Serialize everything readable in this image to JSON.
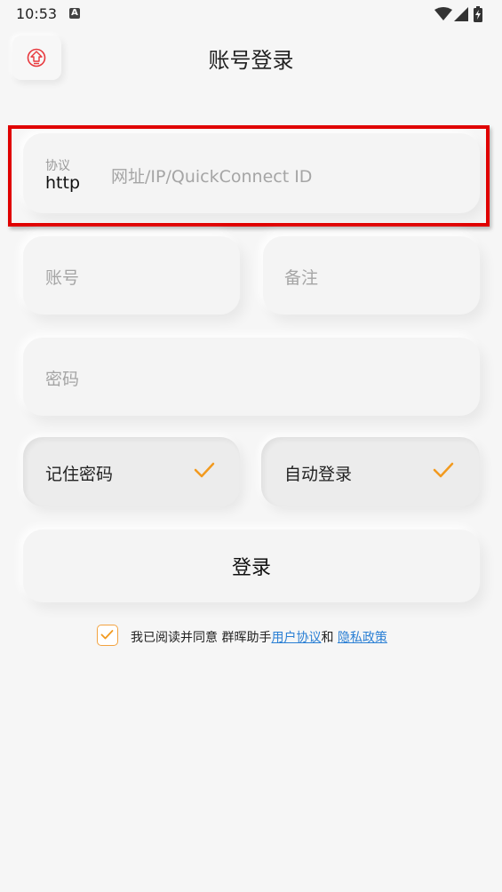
{
  "status_bar": {
    "time": "10:53",
    "notification_glyph": "A",
    "icons": [
      "wifi-icon",
      "signal-icon",
      "battery-charging-icon"
    ]
  },
  "header": {
    "title": "账号登录",
    "back_icon": "back-home-icon",
    "accent_color": "#e8383d"
  },
  "form": {
    "protocol_caption": "协议",
    "protocol_value": "http",
    "url_placeholder": "网址/IP/QuickConnect ID",
    "account_placeholder": "账号",
    "remark_placeholder": "备注",
    "password_placeholder": "密码"
  },
  "options": {
    "remember_label": "记住密码",
    "remember_checked": true,
    "autologin_label": "自动登录",
    "autologin_checked": true,
    "check_color": "#f29a1f"
  },
  "login_button": "登录",
  "agreement": {
    "checked": true,
    "prefix": "我已阅读并同意 群晖助手",
    "user_agreement": "用户协议",
    "and": "和",
    "privacy_policy": "隐私政策",
    "link_color": "#2a7fd4"
  }
}
